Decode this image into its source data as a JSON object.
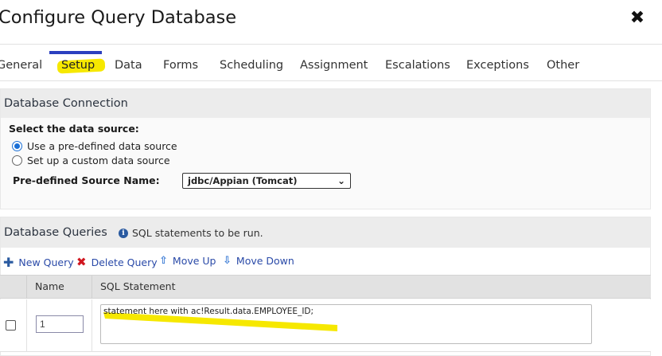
{
  "header": {
    "title_prefix": "Configure ",
    "title_highlight": "Query Database",
    "close_glyph": "✖"
  },
  "tabs": [
    {
      "label": "General",
      "active": false
    },
    {
      "label": "Setup",
      "active": true
    },
    {
      "label": "Data",
      "active": false
    },
    {
      "label": "Forms",
      "active": false
    },
    {
      "label": "Scheduling",
      "active": false
    },
    {
      "label": "Assignment",
      "active": false
    },
    {
      "label": "Escalations",
      "active": false
    },
    {
      "label": "Exceptions",
      "active": false
    },
    {
      "label": "Other",
      "active": false
    }
  ],
  "connection": {
    "title": "Database Connection",
    "select_label": "Select the data source:",
    "options": [
      {
        "label": "Use a pre-defined data source",
        "checked": true
      },
      {
        "label": "Set up a custom data source",
        "checked": false
      }
    ],
    "source_name_label": "Pre-defined Source Name:",
    "source_name_value": "jdbc/Appian (Tomcat)"
  },
  "queries": {
    "title": "Database Queries",
    "info_text": "SQL statements to be run.",
    "toolbar": {
      "new_query": "New Query",
      "delete_query": "Delete Query",
      "move_up": "Move Up",
      "move_down": "Move Down"
    },
    "columns": [
      "Name",
      "SQL Statement"
    ],
    "rows": [
      {
        "checked": false,
        "name": "1",
        "sql": "statement here with ac!Result.data.EMPLOYEE_ID;"
      }
    ]
  },
  "colors": {
    "highlight": "#f6e800",
    "tab_active": "#2b3fbf",
    "link": "#2a4aa8",
    "delete": "#d0161f"
  }
}
